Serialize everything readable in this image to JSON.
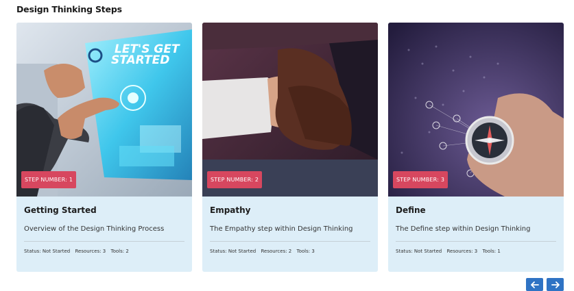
{
  "section": {
    "title": "Design Thinking Steps"
  },
  "cards": [
    {
      "badge": "STEP NUMBER: 1",
      "title": "Getting Started",
      "description": "Overview of the Design Thinking Process",
      "status": "Status: Not Started",
      "resources": "Resources: 3",
      "tools": "Tools: 2",
      "image_text_line1": "LET'S GET",
      "image_text_line2": "STARTED",
      "image_icon": "tablet-lets-get-started-image"
    },
    {
      "badge": "STEP NUMBER: 2",
      "title": "Empathy",
      "description": "The Empathy step within Design Thinking",
      "status": "Status: Not Started",
      "resources": "Resources: 2",
      "tools": "Tools: 3",
      "image_icon": "holding-hands-image"
    },
    {
      "badge": "STEP NUMBER: 3",
      "title": "Define",
      "description": "The Define step within Design Thinking",
      "status": "Status: Not Started",
      "resources": "Resources: 3",
      "tools": "Tools: 1",
      "image_icon": "hand-compass-network-image"
    }
  ],
  "pager": {
    "prev_icon": "arrow-left-icon",
    "next_icon": "arrow-right-icon"
  },
  "colors": {
    "badge": "#d7475f",
    "card_bg": "#ddeef8",
    "pager": "#2f73c4"
  }
}
